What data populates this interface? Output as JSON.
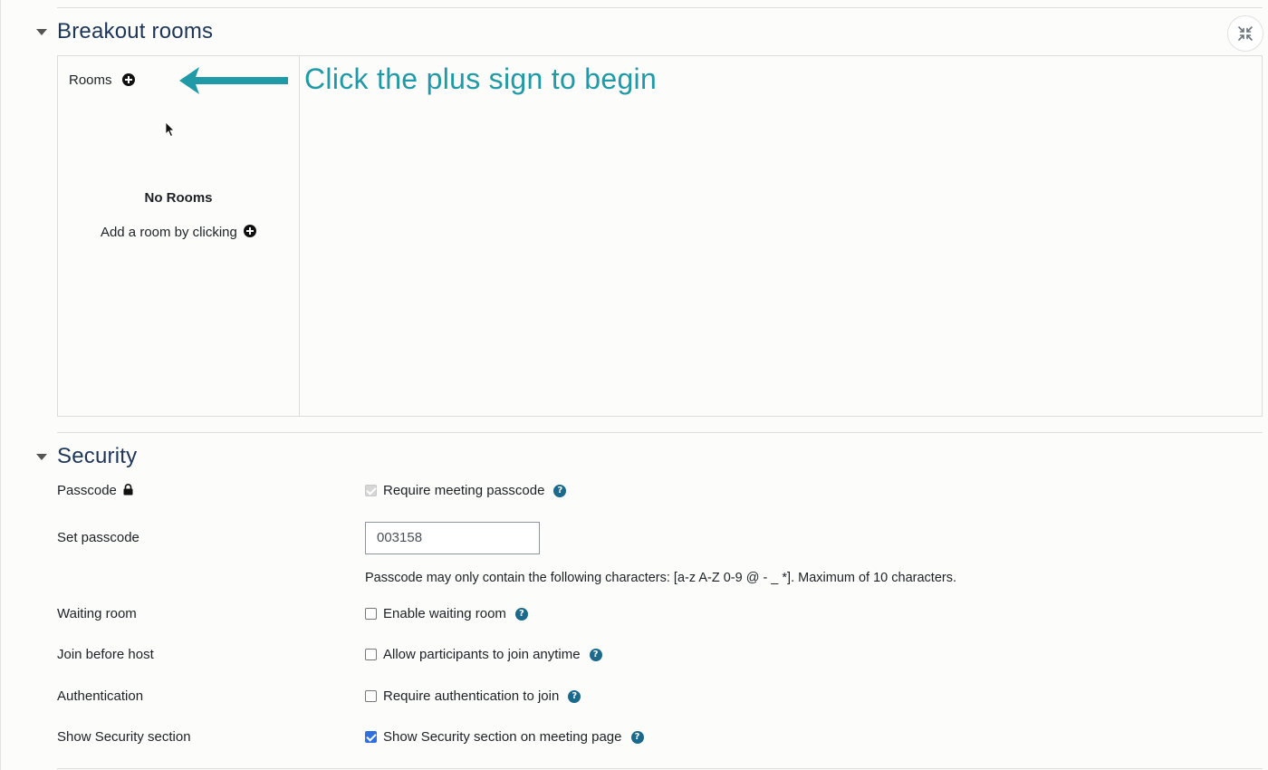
{
  "breakout": {
    "title": "Breakout rooms",
    "rooms_label": "Rooms",
    "empty_title": "No Rooms",
    "empty_hint": "Add a room by clicking",
    "annotation": "Click the plus sign to begin"
  },
  "security": {
    "title": "Security",
    "rows": {
      "passcode": {
        "label": "Passcode",
        "option": "Require meeting passcode",
        "checked": true,
        "disabled": true
      },
      "set_passcode": {
        "label": "Set passcode",
        "value": "003158",
        "note": "Passcode may only contain the following characters: [a-z A-Z 0-9 @ - _ *]. Maximum of 10 characters."
      },
      "waiting_room": {
        "label": "Waiting room",
        "option": "Enable waiting room",
        "checked": false
      },
      "join_before_host": {
        "label": "Join before host",
        "option": "Allow participants to join anytime",
        "checked": false
      },
      "authentication": {
        "label": "Authentication",
        "option": "Require authentication to join",
        "checked": false
      },
      "show_security": {
        "label": "Show Security section",
        "option": "Show Security section on meeting page",
        "checked": true
      }
    }
  },
  "icons": {
    "help": "question-circle-icon",
    "plus": "plus-circle-icon",
    "lock": "lock-icon",
    "collapse": "collapse-all-icon"
  },
  "colors": {
    "annotation": "#1f9aa6",
    "heading": "#1d3557",
    "checkbox_checked": "#2f6fde",
    "help_icon": "#1b6a8c"
  }
}
